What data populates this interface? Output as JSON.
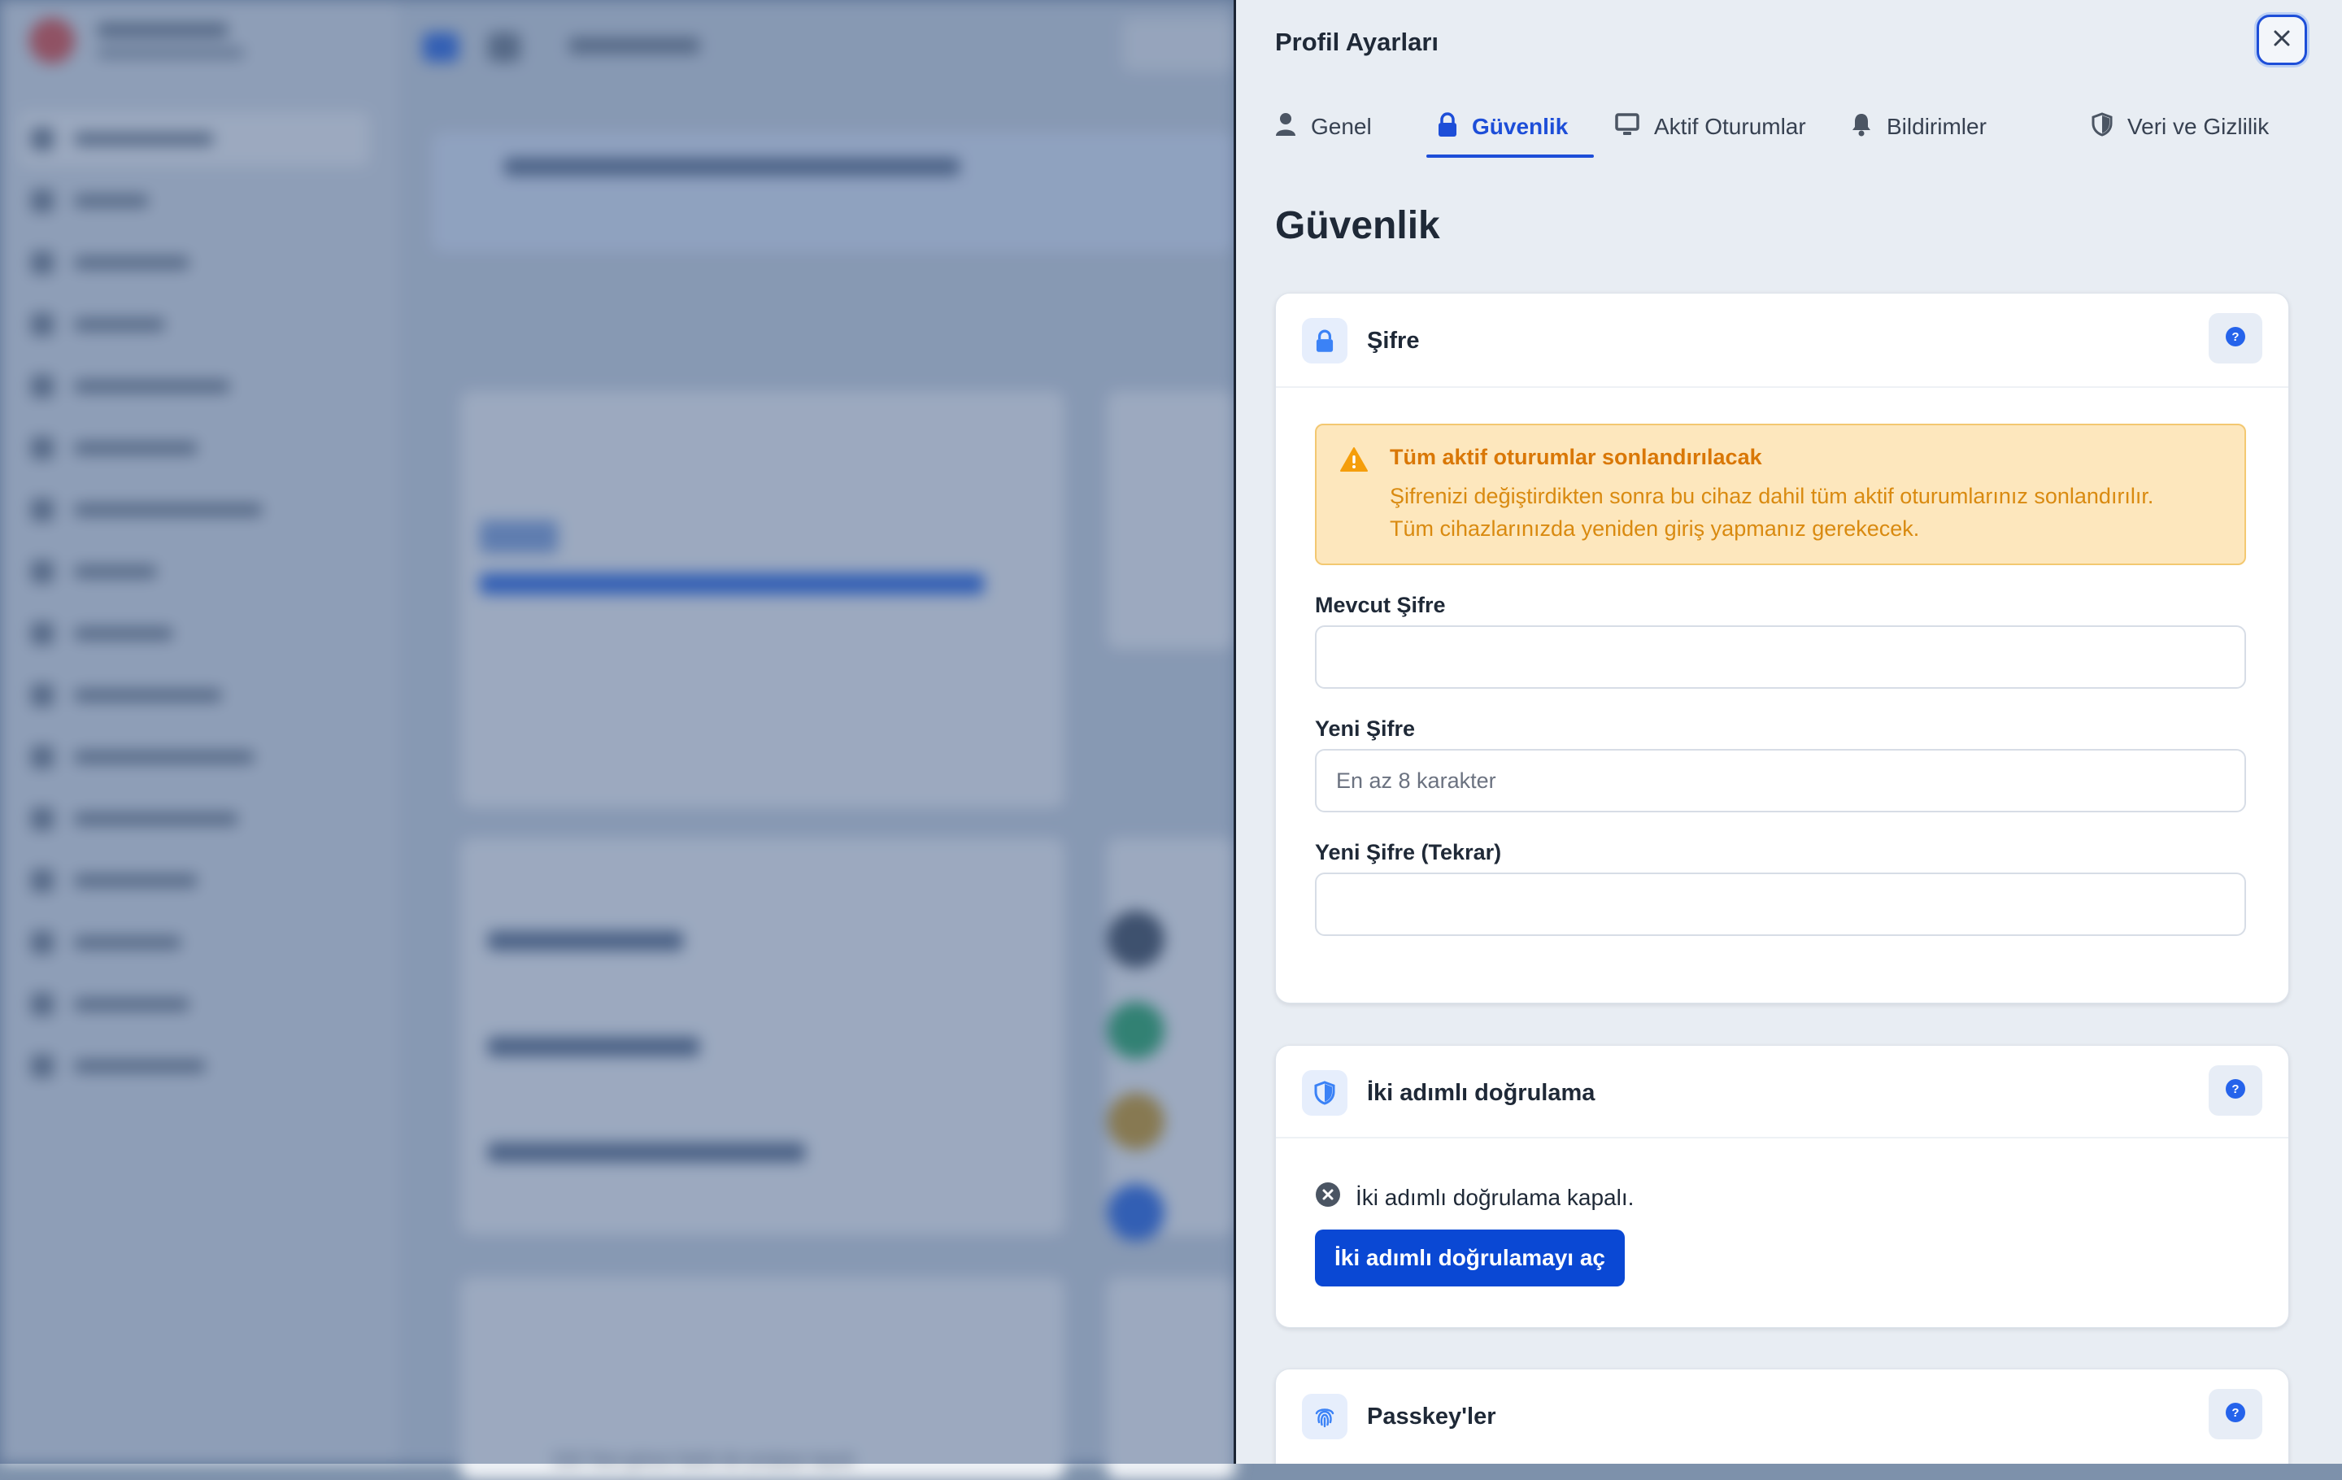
{
  "panel": {
    "title": "Profil Ayarları",
    "close_icon": "close-icon",
    "tabs": [
      {
        "label": "Genel",
        "icon": "user-icon",
        "active": false
      },
      {
        "label": "Güvenlik",
        "icon": "lock-icon",
        "active": true
      },
      {
        "label": "Aktif Oturumlar",
        "icon": "monitor-icon",
        "active": false
      },
      {
        "label": "Bildirimler",
        "icon": "bell-icon",
        "active": false
      },
      {
        "label": "Veri ve Gizlilik",
        "icon": "shield-icon",
        "active": false
      }
    ],
    "section_title": "Güvenlik"
  },
  "password_card": {
    "title": "Şifre",
    "icon": "lock-icon",
    "help_icon": "help-icon",
    "alert": {
      "icon": "warning-icon",
      "title": "Tüm aktif oturumlar sonlandırılacak",
      "line1": "Şifrenizi değiştirdikten sonra bu cihaz dahil tüm aktif oturumlarınız sonlandırılır.",
      "line2": "Tüm cihazlarınızda yeniden giriş yapmanız gerekecek."
    },
    "current_label": "Mevcut Şifre",
    "current_value": "",
    "new_label": "Yeni Şifre",
    "new_placeholder": "En az 8 karakter",
    "confirm_label": "Yeni Şifre (Tekrar)",
    "confirm_value": ""
  },
  "twofa_card": {
    "title": "İki adımlı doğrulama",
    "icon": "shield-icon",
    "help_icon": "help-icon",
    "status_icon": "x-circle-icon",
    "status_text": "İki adımlı doğrulama kapalı.",
    "enable_button": "İki adımlı doğrulamayı aç"
  },
  "passkey_card": {
    "title": "Passkey'ler",
    "icon": "fingerprint-icon",
    "help_icon": "help-icon"
  },
  "background": {
    "footer_text": "526 Test görevi farklı bir projeye taşıdı"
  },
  "colors": {
    "accent": "#1d4ed8",
    "primary_button": "#0a48d4",
    "warning_bg": "#fde7bd",
    "warning_text": "#d97706"
  }
}
